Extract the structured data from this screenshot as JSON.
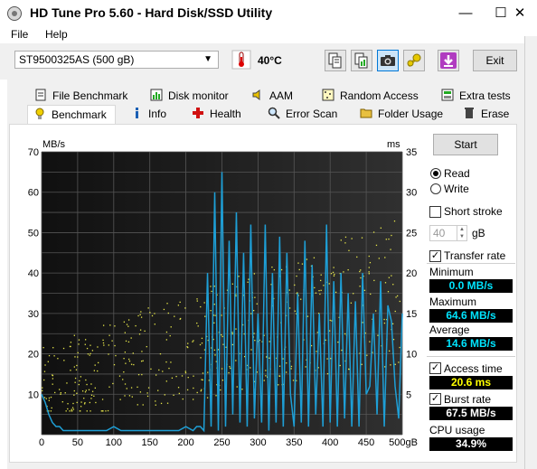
{
  "window": {
    "title": "HD Tune Pro 5.60 - Hard Disk/SSD Utility",
    "minimize": "—",
    "maximize": "☐",
    "close": "✕"
  },
  "menu": {
    "file": "File",
    "help": "Help"
  },
  "toolbar": {
    "drive": "ST9500325AS (500 gB)",
    "temperature": "40°C",
    "exit_label": "Exit"
  },
  "tabs_top": [
    "File Benchmark",
    "Disk monitor",
    "AAM",
    "Random Access",
    "Extra tests"
  ],
  "tabs_bottom": [
    "Benchmark",
    "Info",
    "Health",
    "Error Scan",
    "Folder Usage",
    "Erase"
  ],
  "controls": {
    "start_label": "Start",
    "read_label": "Read",
    "write_label": "Write",
    "short_stroke_label": "Short stroke",
    "short_stroke_value": "40",
    "short_stroke_unit": "gB",
    "transfer_rate_label": "Transfer rate"
  },
  "stats": {
    "minimum_label": "Minimum",
    "minimum_value": "0.0 MB/s",
    "maximum_label": "Maximum",
    "maximum_value": "64.6 MB/s",
    "average_label": "Average",
    "average_value": "14.6 MB/s",
    "access_time_label": "Access time",
    "access_time_value": "20.6 ms",
    "burst_rate_label": "Burst rate",
    "burst_rate_value": "67.5 MB/s",
    "cpu_usage_label": "CPU usage",
    "cpu_usage_value": "34.9%"
  },
  "colors": {
    "transfer_line": "#1e9fd6",
    "access_dots": "#e8e84a",
    "cyan_value": "#00e5ff",
    "yellow_value": "#ffff00"
  },
  "chart_data": {
    "type": "line",
    "ylabel_left": "MB/s",
    "ylabel_right": "ms",
    "xlabel": "gB",
    "x_ticks": [
      "0",
      "50",
      "100",
      "150",
      "200",
      "250",
      "300",
      "350",
      "400",
      "450",
      "500gB"
    ],
    "y_left_ticks": [
      "70",
      "60",
      "50",
      "40",
      "30",
      "20",
      "10"
    ],
    "y_right_ticks": [
      "35",
      "30",
      "25",
      "20",
      "15",
      "10",
      "5"
    ],
    "xlim": [
      0,
      500
    ],
    "ylim_left": [
      0,
      70
    ],
    "ylim_right": [
      0,
      35
    ],
    "grid": true,
    "series": [
      {
        "name": "Transfer rate",
        "axis": "left",
        "x": [
          0,
          5,
          10,
          15,
          20,
          25,
          30,
          40,
          50,
          60,
          70,
          80,
          90,
          100,
          110,
          120,
          130,
          140,
          150,
          160,
          170,
          180,
          190,
          200,
          210,
          215,
          220,
          225,
          230,
          235,
          240,
          245,
          250,
          255,
          260,
          265,
          270,
          275,
          280,
          285,
          290,
          295,
          300,
          305,
          310,
          315,
          320,
          325,
          330,
          335,
          340,
          345,
          350,
          355,
          360,
          365,
          370,
          375,
          380,
          385,
          390,
          395,
          400,
          405,
          410,
          415,
          420,
          425,
          430,
          435,
          440,
          445,
          450,
          455,
          460,
          465,
          470,
          475,
          480,
          485,
          490,
          495,
          500
        ],
        "y": [
          10,
          8,
          5,
          3,
          2,
          2,
          1,
          1,
          1,
          1,
          1,
          1,
          1,
          2,
          1,
          1,
          1,
          1,
          1,
          1,
          1,
          1,
          1,
          2,
          1,
          2,
          2,
          1,
          40,
          2,
          60,
          1,
          65,
          2,
          48,
          5,
          55,
          3,
          45,
          2,
          52,
          4,
          30,
          3,
          52,
          1,
          40,
          3,
          49,
          2,
          45,
          10,
          2,
          35,
          3,
          48,
          2,
          42,
          5,
          30,
          2,
          52,
          3,
          38,
          2,
          40,
          4,
          35,
          2,
          33,
          2,
          40,
          10,
          12,
          30,
          5,
          38,
          2,
          32,
          28,
          12,
          4,
          30
        ]
      }
    ]
  }
}
